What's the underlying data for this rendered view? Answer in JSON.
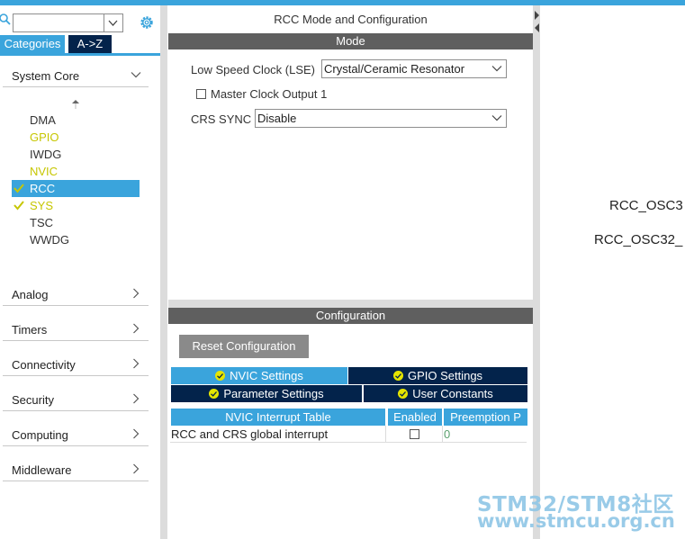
{
  "left_panel": {
    "search": {
      "value": "",
      "placeholder": ""
    },
    "tabs": {
      "categories": "Categories",
      "az": "A->Z"
    },
    "system_core": {
      "label": "System Core",
      "items": [
        {
          "label": "DMA",
          "state": "normal"
        },
        {
          "label": "GPIO",
          "state": "warn"
        },
        {
          "label": "IWDG",
          "state": "normal"
        },
        {
          "label": "NVIC",
          "state": "warn"
        },
        {
          "label": "RCC",
          "state": "selected"
        },
        {
          "label": "SYS",
          "state": "checked"
        },
        {
          "label": "TSC",
          "state": "normal"
        },
        {
          "label": "WWDG",
          "state": "normal"
        }
      ]
    },
    "categories": [
      "Analog",
      "Timers",
      "Connectivity",
      "Security",
      "Computing",
      "Middleware"
    ]
  },
  "mode_panel": {
    "title": "RCC Mode and Configuration",
    "section": "Mode",
    "lse_label": "Low Speed Clock (LSE)",
    "lse_value": "Crystal/Ceramic Resonator",
    "mco_label": "Master Clock Output 1",
    "crs_label": "CRS SYNC",
    "crs_value": "Disable"
  },
  "config_panel": {
    "section": "Configuration",
    "reset_button": "Reset Configuration",
    "tabs": {
      "nvic": "NVIC Settings",
      "gpio": "GPIO Settings",
      "param": "Parameter Settings",
      "user": "User Constants"
    },
    "table": {
      "headers": {
        "name": "NVIC Interrupt Table",
        "enabled": "Enabled",
        "preemption": "Preemption P"
      },
      "rows": [
        {
          "name": "RCC and CRS global interrupt",
          "enabled": false,
          "preemption": "0"
        }
      ]
    }
  },
  "pinout": {
    "pin1": "RCC_OSC3",
    "pin2": "RCC_OSC32_"
  },
  "watermark": {
    "line1": "STM32/STM8社区",
    "line2": "www.stmcu.org.cn"
  },
  "colors": {
    "accent": "#3aa4dc",
    "dark": "#03234b",
    "warn": "#c6c600",
    "section": "#5f5f5f"
  }
}
